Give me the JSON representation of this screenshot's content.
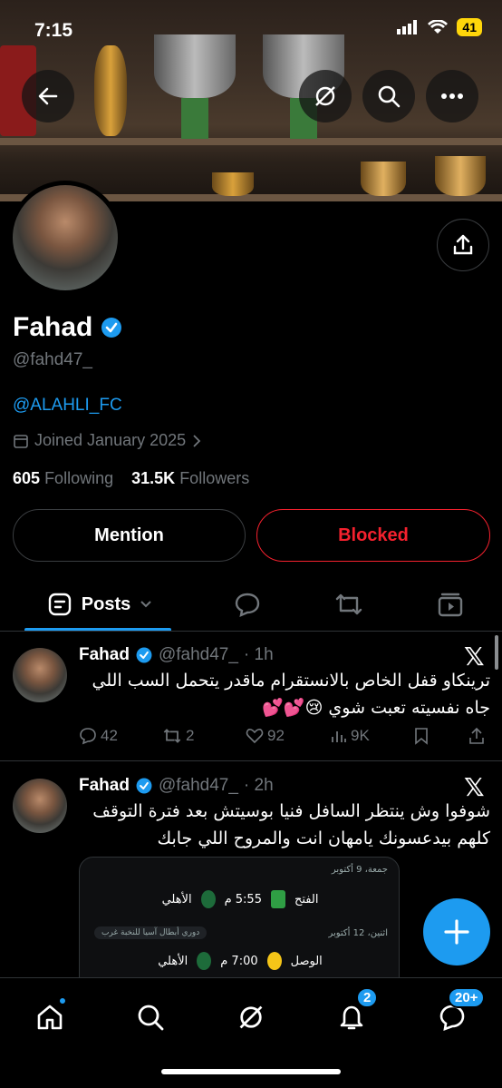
{
  "status_bar": {
    "time": "7:15",
    "battery": "41"
  },
  "profile": {
    "name": "Fahad",
    "handle": "@fahd47_",
    "bio_link": "@ALAHLI_FC",
    "joined": "Joined January 2025",
    "following_count": "605",
    "following_label": "Following",
    "followers_count": "31.5K",
    "followers_label": "Followers"
  },
  "buttons": {
    "mention": "Mention",
    "blocked": "Blocked"
  },
  "tabs": {
    "posts": "Posts"
  },
  "posts": [
    {
      "name": "Fahad",
      "handle": "@fahd47_",
      "time": "· 1h",
      "text": "ترينكاو قفل الخاص بالانستقرام ماقدر يتحمل السب اللي جاه نفسيته تعبت شوي 😢💕💕",
      "replies": "42",
      "reposts": "2",
      "likes": "92",
      "views": "9K"
    },
    {
      "name": "Fahad",
      "handle": "@fahd47_",
      "time": "· 2h",
      "text": "شوفوا وش ينتظر السافل فنيا بوسيتش بعد فترة التوقف كلهم بيدعسونك يامهان انت والمروح اللي جابك"
    }
  ],
  "card": {
    "date1": "جمعة، 9 أكتوبر",
    "match1_home": "الفتح",
    "match1_time": "5:55 م",
    "match1_away": "الأهلي",
    "competition": "دوري أبطال آسيا للنخبة غرب",
    "date2": "اثنين، 12 أكتوبر",
    "match2_home": "الوصل",
    "match2_time": "7:00 م",
    "match2_away": "الأهلي"
  },
  "nav": {
    "notifications_badge": "2",
    "messages_badge": "20+"
  },
  "colors": {
    "accent": "#1d9bf0",
    "danger": "#f4212e",
    "background": "#000000",
    "muted": "#71767b"
  }
}
